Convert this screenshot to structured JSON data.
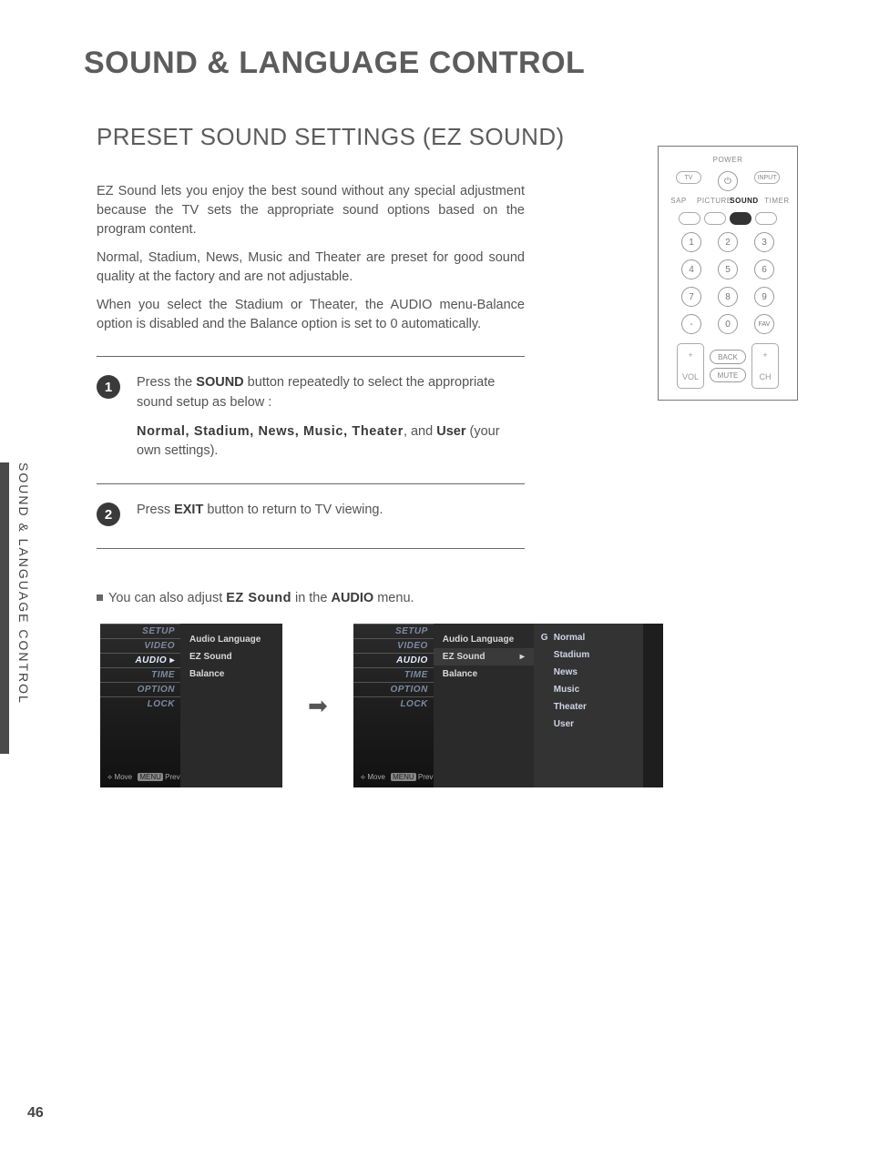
{
  "page_number": "46",
  "side_tab": "SOUND & LANGUAGE CONTROL",
  "h1": "SOUND & LANGUAGE CONTROL",
  "h2": "PRESET SOUND SETTINGS (EZ SOUND)",
  "intro": {
    "p1": "EZ Sound lets you enjoy the best sound without any special adjustment because the TV sets the appropriate sound options based on the program content.",
    "p2": "Normal, Stadium, News, Music and Theater are preset for good sound quality at the factory and are not adjustable.",
    "p3": "When you select the Stadium or Theater, the AUDIO menu-Balance option is disabled and the Balance option is set to 0 automatically."
  },
  "steps": {
    "s1_num": "1",
    "s1_pre": "Press the ",
    "s1_b1": "SOUND",
    "s1_mid": " button repeatedly to select the appropriate sound setup as below :",
    "s1_opts": "Normal, Stadium, News, Music, Theater",
    "s1_and": ", and ",
    "s1_user": "User",
    "s1_tail": " (your own settings).",
    "s2_num": "2",
    "s2_pre": "Press ",
    "s2_b": "EXIT",
    "s2_tail": " button to return to TV viewing."
  },
  "note": {
    "pre": "You can also adjust ",
    "b1": "EZ Sound",
    "mid": " in the ",
    "b2": "AUDIO",
    "tail": " menu."
  },
  "remote": {
    "power": "POWER",
    "tv": "TV",
    "input": "INPUT",
    "sap": "SAP",
    "picture": "PICTURE",
    "sound": "SOUND",
    "timer": "TIMER",
    "k1": "1",
    "k2": "2",
    "k3": "3",
    "k4": "4",
    "k5": "5",
    "k6": "6",
    "k7": "7",
    "k8": "8",
    "k9": "9",
    "k0": "0",
    "kdash": "-",
    "kfav": "FAV",
    "back": "BACK",
    "mute": "MUTE",
    "vol": "VOL",
    "ch": "CH",
    "plus": "+"
  },
  "osd": {
    "tabs": {
      "setup": "SETUP",
      "video": "VIDEO",
      "audio": "AUDIO",
      "time": "TIME",
      "option": "OPTION",
      "lock": "LOCK"
    },
    "items": {
      "lang": "Audio Language",
      "ez": "EZ Sound",
      "bal": "Balance"
    },
    "opts": {
      "normal": "Normal",
      "stadium": "Stadium",
      "news": "News",
      "music": "Music",
      "theater": "Theater",
      "user": "User"
    },
    "footer_move": "Move",
    "footer_prev": "Prev"
  }
}
